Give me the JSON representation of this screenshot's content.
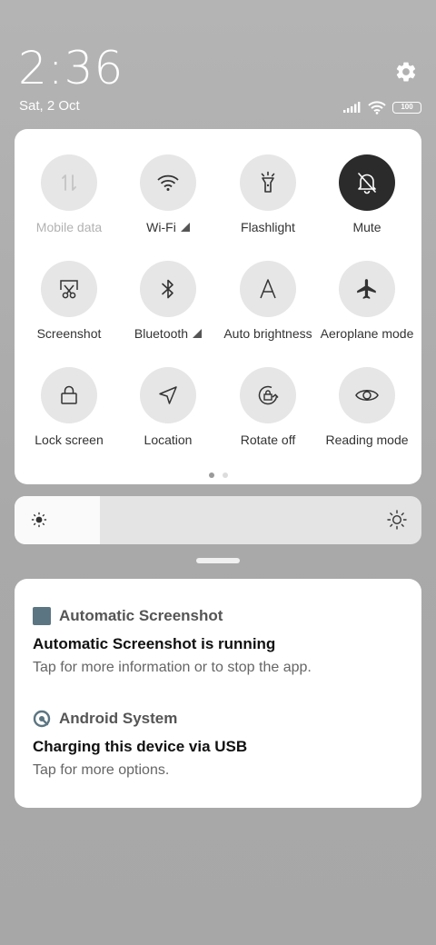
{
  "header": {
    "time": "2:36",
    "date": "Sat, 2 Oct",
    "battery_level": "100",
    "icons": [
      "signal-icon",
      "wifi-icon",
      "battery-icon",
      "settings-gear-icon"
    ]
  },
  "quick_settings": {
    "tiles": [
      {
        "label": "Mobile data",
        "icon": "mobile-data-icon",
        "state": "unavailable"
      },
      {
        "label": "Wi-Fi",
        "icon": "wifi-icon",
        "state": "off",
        "expandable": true
      },
      {
        "label": "Flashlight",
        "icon": "flashlight-icon",
        "state": "off"
      },
      {
        "label": "Mute",
        "icon": "bell-off-icon",
        "state": "on"
      },
      {
        "label": "Screenshot",
        "icon": "screenshot-scissors-icon",
        "state": "off"
      },
      {
        "label": "Bluetooth",
        "icon": "bluetooth-icon",
        "state": "off",
        "expandable": true
      },
      {
        "label": "Auto brightness",
        "icon": "auto-brightness-icon",
        "state": "off"
      },
      {
        "label": "Aeroplane mode",
        "icon": "airplane-icon",
        "state": "off"
      },
      {
        "label": "Lock screen",
        "icon": "lock-icon",
        "state": "off"
      },
      {
        "label": "Location",
        "icon": "location-arrow-icon",
        "state": "off"
      },
      {
        "label": "Rotate off",
        "icon": "rotation-lock-icon",
        "state": "off"
      },
      {
        "label": "Reading mode",
        "icon": "eye-icon",
        "state": "off"
      }
    ],
    "page_count": 2,
    "active_page": 1
  },
  "brightness": {
    "level": 0.21
  },
  "notifications": [
    {
      "app": "Automatic Screenshot",
      "app_icon": "app-square-icon",
      "title": "Automatic Screenshot is running",
      "body": "Tap for more information or to stop the app."
    },
    {
      "app": "Android System",
      "app_icon": "android-system-icon",
      "title": "Charging this device via USB",
      "body": "Tap for more options."
    }
  ],
  "colors": {
    "tile_off": "#e6e6e6",
    "tile_on": "#2b2b2b",
    "app_icon": "#5c7582"
  }
}
